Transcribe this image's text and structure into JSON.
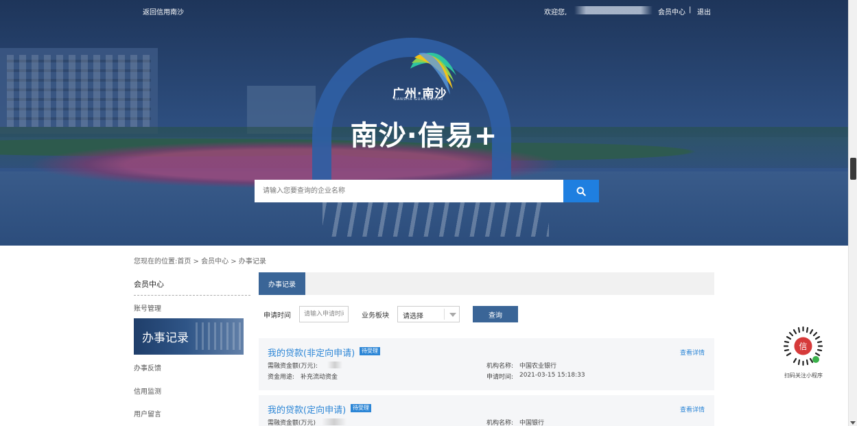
{
  "topbar": {
    "back_link": "返回信用南沙",
    "welcome": "欢迎您,",
    "member_center": "会员中心",
    "separator": "|",
    "logout": "退出"
  },
  "hero": {
    "logo_text": "广州·南沙",
    "logo_sub": "NANSHA·GUANGZHOU",
    "title": "南沙·信易+"
  },
  "search": {
    "placeholder": "请输入您要查询的企业名称",
    "icon": "search-icon"
  },
  "breadcrumb": "您现在的位置:首页 > 会员中心 > 办事记录",
  "sidebar": {
    "title": "会员中心",
    "items": [
      {
        "label": "账号管理",
        "active": false
      },
      {
        "label": "办事记录",
        "active": true
      },
      {
        "label": "办事反馈",
        "active": false
      },
      {
        "label": "信用监测",
        "active": false
      },
      {
        "label": "用户留言",
        "active": false
      }
    ]
  },
  "main": {
    "tab": "办事记录",
    "filters": {
      "time_label": "申请时间",
      "time_placeholder": "请输入申请时间",
      "sector_label": "业务板块",
      "sector_value": "请选择",
      "query_button": "查询"
    },
    "records": [
      {
        "title": "我的贷款(非定向申请)",
        "status": "待受理",
        "detail_link": "查看详情",
        "amount_label": "需融资金额(万元):",
        "purpose_label": "资金用途:",
        "purpose_value": "补充流动资金",
        "org_label": "机构名称:",
        "org_value": "中国农业银行",
        "time_label": "申请时间:",
        "time_value": "2021-03-15 15:18:33"
      },
      {
        "title": "我的贷款(定向申请)",
        "status": "待受理",
        "detail_link": "查看详情",
        "amount_label": "需融资金额(万元)",
        "org_label": "机构名称:",
        "org_value": "中国银行"
      }
    ]
  },
  "qr": {
    "label": "扫码关注小程序"
  },
  "colors": {
    "accent_blue": "#2c86d6",
    "nav_blue": "#3a6597",
    "search_button": "#1f7fe0"
  }
}
